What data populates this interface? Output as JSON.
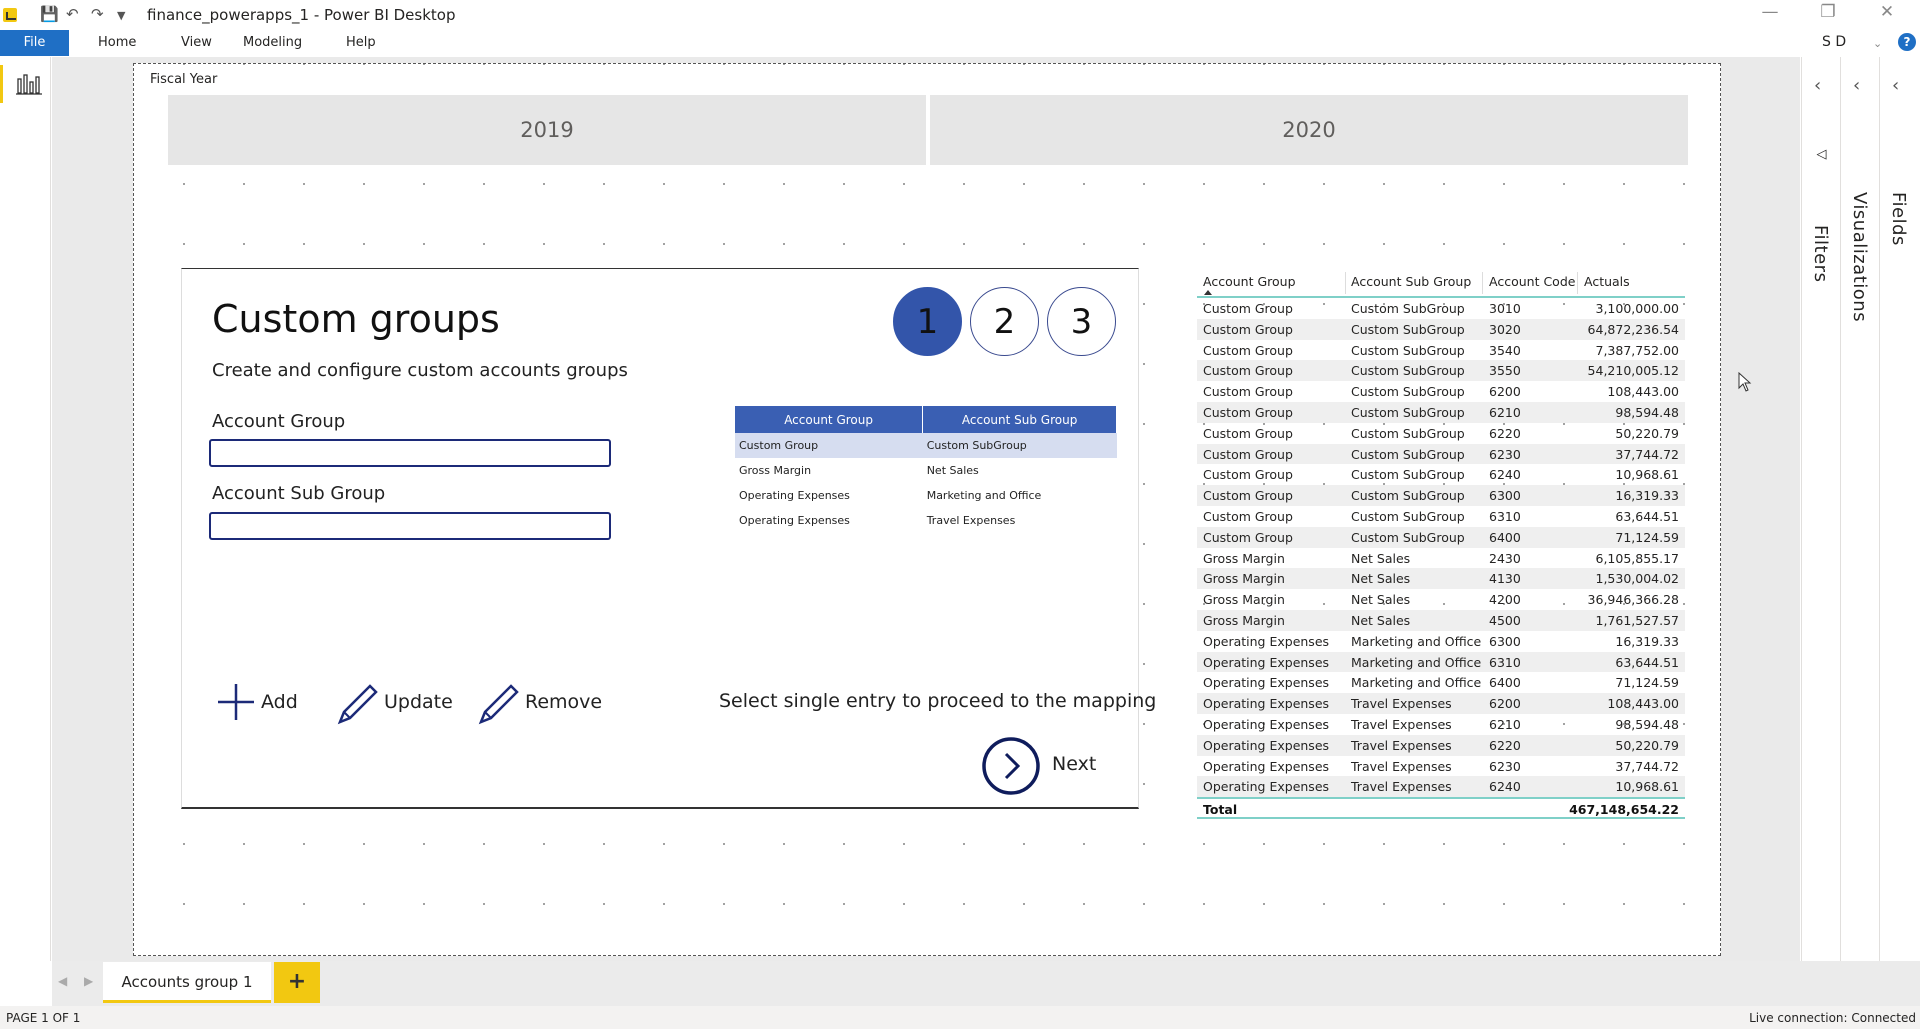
{
  "titlebar": {
    "title": "finance_powerapps_1 - Power BI Desktop",
    "icons": [
      "powerbi-logo",
      "save-icon",
      "undo-icon",
      "redo-icon",
      "customize-dropdown-icon"
    ],
    "controls": [
      "minimize",
      "restore",
      "close"
    ]
  },
  "menu": {
    "file": "File",
    "items": [
      "Home",
      "View",
      "Modeling",
      "Help"
    ],
    "user": "S D",
    "help": "?"
  },
  "slicer": {
    "title": "Fiscal Year",
    "options": [
      "2019",
      "2020"
    ]
  },
  "app": {
    "title": "Custom groups",
    "subtitle": "Create and configure custom accounts groups",
    "account_group_label": "Account Group",
    "account_group_value": "",
    "account_sub_group_label": "Account Sub Group",
    "account_sub_group_value": "",
    "steps": [
      "1",
      "2",
      "3"
    ],
    "active_step": "1",
    "table": {
      "headers": [
        "Account Group",
        "Account Sub Group"
      ],
      "rows": [
        [
          "Custom Group",
          "Custom SubGroup"
        ],
        [
          "Gross Margin",
          "Net Sales"
        ],
        [
          "Operating Expenses",
          "Marketing and Office"
        ],
        [
          "Operating Expenses",
          "Travel Expenses"
        ]
      ]
    },
    "actions": {
      "add": "Add",
      "update": "Update",
      "remove": "Remove"
    },
    "hint": "Select single entry to proceed to the mapping",
    "next": "Next"
  },
  "matrix": {
    "headers": [
      "Account Group",
      "Account Sub Group",
      "Account Code",
      "Actuals"
    ],
    "rows": [
      [
        "Custom Group",
        "Custom SubGroup",
        "3010",
        "3,100,000.00"
      ],
      [
        "Custom Group",
        "Custom SubGroup",
        "3020",
        "64,872,236.54"
      ],
      [
        "Custom Group",
        "Custom SubGroup",
        "3540",
        "7,387,752.00"
      ],
      [
        "Custom Group",
        "Custom SubGroup",
        "3550",
        "54,210,005.12"
      ],
      [
        "Custom Group",
        "Custom SubGroup",
        "6200",
        "108,443.00"
      ],
      [
        "Custom Group",
        "Custom SubGroup",
        "6210",
        "98,594.48"
      ],
      [
        "Custom Group",
        "Custom SubGroup",
        "6220",
        "50,220.79"
      ],
      [
        "Custom Group",
        "Custom SubGroup",
        "6230",
        "37,744.72"
      ],
      [
        "Custom Group",
        "Custom SubGroup",
        "6240",
        "10,968.61"
      ],
      [
        "Custom Group",
        "Custom SubGroup",
        "6300",
        "16,319.33"
      ],
      [
        "Custom Group",
        "Custom SubGroup",
        "6310",
        "63,644.51"
      ],
      [
        "Custom Group",
        "Custom SubGroup",
        "6400",
        "71,124.59"
      ],
      [
        "Gross Margin",
        "Net Sales",
        "2430",
        "6,105,855.17"
      ],
      [
        "Gross Margin",
        "Net Sales",
        "4130",
        "1,530,004.02"
      ],
      [
        "Gross Margin",
        "Net Sales",
        "4200",
        "36,946,366.28"
      ],
      [
        "Gross Margin",
        "Net Sales",
        "4500",
        "1,761,527.57"
      ],
      [
        "Operating Expenses",
        "Marketing and Office",
        "6300",
        "16,319.33"
      ],
      [
        "Operating Expenses",
        "Marketing and Office",
        "6310",
        "63,644.51"
      ],
      [
        "Operating Expenses",
        "Marketing and Office",
        "6400",
        "71,124.59"
      ],
      [
        "Operating Expenses",
        "Travel Expenses",
        "6200",
        "108,443.00"
      ],
      [
        "Operating Expenses",
        "Travel Expenses",
        "6210",
        "98,594.48"
      ],
      [
        "Operating Expenses",
        "Travel Expenses",
        "6220",
        "50,220.79"
      ],
      [
        "Operating Expenses",
        "Travel Expenses",
        "6230",
        "37,744.72"
      ],
      [
        "Operating Expenses",
        "Travel Expenses",
        "6240",
        "10,968.61"
      ]
    ],
    "total_label": "Total",
    "total_value": "467,148,654.22"
  },
  "panes": {
    "filters": "Filters",
    "visualizations": "Visualizations",
    "fields": "Fields"
  },
  "tabs": {
    "pages": [
      "Accounts group 1"
    ],
    "add": "+"
  },
  "status": {
    "page": "PAGE 1 OF 1",
    "connection": "Live connection: Connected"
  },
  "colors": {
    "accent": "#F2C811",
    "file_tab": "#1f6fc5",
    "app_primary": "#3355aa",
    "table_header": "#3a5fb3",
    "input_border": "#1c2a78"
  }
}
